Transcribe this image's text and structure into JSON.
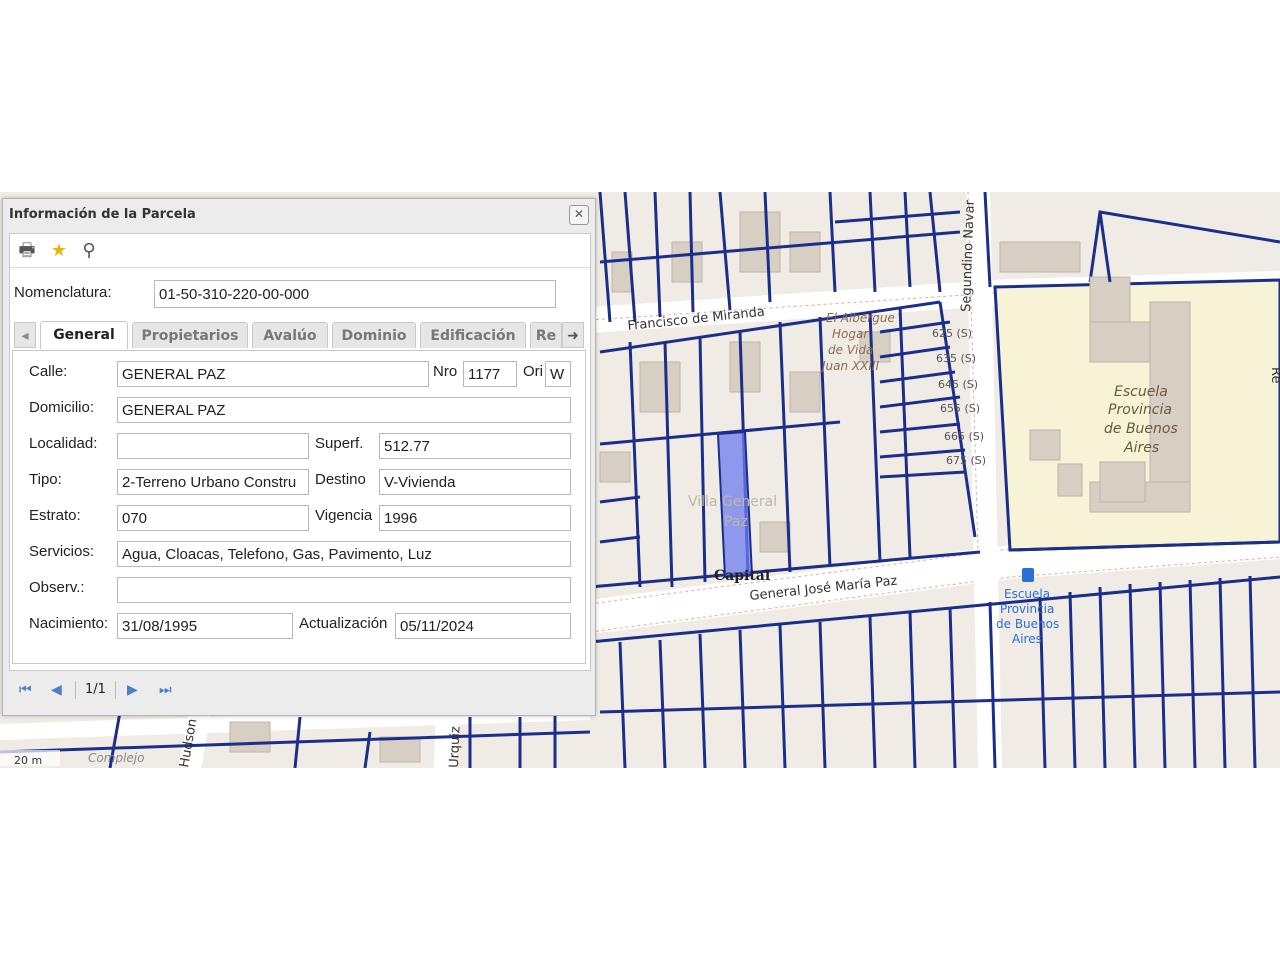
{
  "map": {
    "streets": {
      "miranda": "Francisco de Miranda",
      "segundino": "Segundino Navar",
      "paz": "General José María Paz",
      "hudson": "Hudson",
      "urquiza": "Urquiz",
      "re": "Re"
    },
    "pois": {
      "albergue": [
        "El Albergue",
        "Hogar",
        "de Vida",
        "Juan XXIII"
      ],
      "villa": [
        "Villa General",
        "Paz"
      ],
      "capital": "Capital",
      "complejo": "Complejo",
      "school_big": [
        "Escuela",
        "Provincia",
        "de Buenos",
        "Aires"
      ],
      "school_stop": [
        "Escuela",
        "Provincia",
        "de Buenos",
        "Aires"
      ]
    },
    "house_numbers": [
      "625 (S)",
      "635 (S)",
      "645 (S)",
      "655 (S)",
      "665 (S)",
      "675 (S)"
    ],
    "scale": "20 m",
    "colors": {
      "parcel_line": "#1b2f8a",
      "selected": "#6d7ef0",
      "school_area": "#f7f3d7"
    }
  },
  "dialog": {
    "title": "Información de la Parcela",
    "close_icon": "close-icon",
    "toolbar": {
      "print_icon": "print-icon",
      "star_icon": "star-icon",
      "zoom_icon": "zoom-icon"
    },
    "nomenclatura_label": "Nomenclatura:",
    "nomenclatura_value": "01-50-310-220-00-000",
    "tabs": [
      "General",
      "Propietarios",
      "Avalúo",
      "Dominio",
      "Edificación",
      "Re"
    ],
    "active_tab": "General",
    "fields": {
      "calle_label": "Calle:",
      "calle_value": "GENERAL PAZ",
      "nro_label": "Nro",
      "nro_value": "1177",
      "ori_label": "Ori",
      "ori_value": "W",
      "domicilio_label": "Domicilio:",
      "domicilio_value": "GENERAL PAZ",
      "localidad_label": "Localidad:",
      "localidad_value": "",
      "superf_label": "Superf.",
      "superf_value": "512.77",
      "tipo_label": "Tipo:",
      "tipo_value": "2-Terreno Urbano Constru",
      "destino_label": "Destino",
      "destino_value": "V-Vivienda",
      "estrato_label": "Estrato:",
      "estrato_value": "070",
      "vigencia_label": "Vigencia",
      "vigencia_value": "1996",
      "servicios_label": "Servicios:",
      "servicios_value": "Agua, Cloacas, Telefono, Gas, Pavimento, Luz",
      "observ_label": "Observ.:",
      "observ_value": "",
      "nacimiento_label": "Nacimiento:",
      "nacimiento_value": "31/08/1995",
      "actualizacion_label": "Actualización",
      "actualizacion_value": "05/11/2024"
    },
    "pager": {
      "text": "1/1"
    }
  }
}
